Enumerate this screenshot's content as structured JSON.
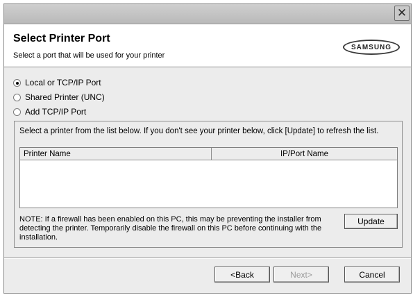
{
  "header": {
    "title": "Select Printer Port",
    "subtitle": "Select a port that will be used for your printer",
    "logo_text": "SAMSUNG"
  },
  "titlebar": {
    "close_icon": "close-icon"
  },
  "port_options": [
    {
      "label": "Local or TCP/IP Port",
      "selected": true
    },
    {
      "label": "Shared Printer (UNC)",
      "selected": false
    },
    {
      "label": "Add TCP/IP Port",
      "selected": false
    }
  ],
  "group": {
    "instruction": "Select a printer from the list below. If you don't see your printer below, click [Update] to refresh the list.",
    "columns": [
      "Printer Name",
      "IP/Port Name"
    ],
    "rows": [],
    "note": "NOTE: If a firewall has been enabled on this PC, this may be preventing the installer from detecting the printer. Temporarily disable the firewall on this PC before continuing with the installation.",
    "update_label": "Update"
  },
  "footer": {
    "back_label": "<Back",
    "next_label": "Next>",
    "cancel_label": "Cancel",
    "next_disabled": true
  }
}
